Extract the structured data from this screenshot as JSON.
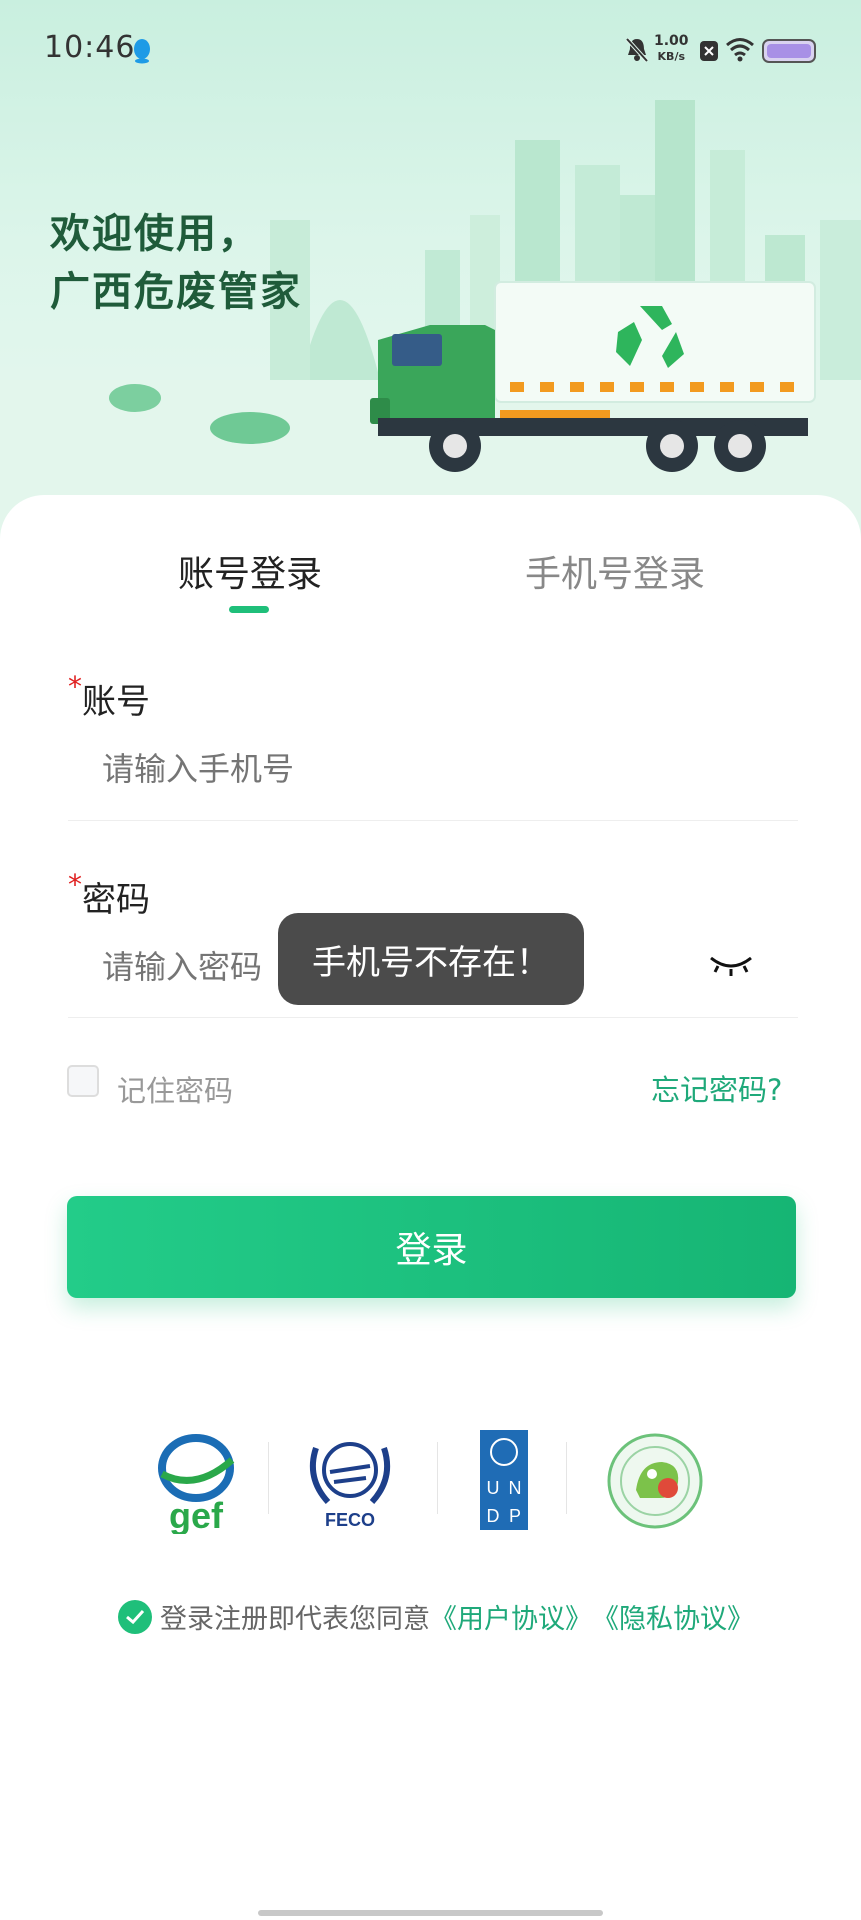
{
  "status_bar": {
    "time": "10:46",
    "net_speed_value": "1.00",
    "net_speed_unit": "KB/s"
  },
  "hero": {
    "welcome_line1": "欢迎使用，",
    "welcome_line2": "广西危废管家"
  },
  "tabs": [
    {
      "label": "账号登录",
      "active": true
    },
    {
      "label": "手机号登录",
      "active": false
    }
  ],
  "form": {
    "account": {
      "required_mark": "*",
      "label": "账号",
      "placeholder": "请输入手机号"
    },
    "password": {
      "required_mark": "*",
      "label": "密码",
      "placeholder": "请输入密码"
    },
    "remember_label": "记住密码",
    "forgot_label": "忘记密码?",
    "login_label": "登录"
  },
  "logos": [
    {
      "name": "gef",
      "text": "gef"
    },
    {
      "name": "feco",
      "text": "FECO"
    },
    {
      "name": "undp",
      "text": "UNDP"
    },
    {
      "name": "seal"
    }
  ],
  "agreement": {
    "prefix": "登录注册即代表您同意",
    "user_agreement": "《用户协议》",
    "privacy_agreement": "《隐私协议》"
  },
  "toast": {
    "message": "手机号不存在！"
  },
  "colors": {
    "accent": "#1fbf7a",
    "link": "#1fa97a",
    "required": "#e02020"
  }
}
